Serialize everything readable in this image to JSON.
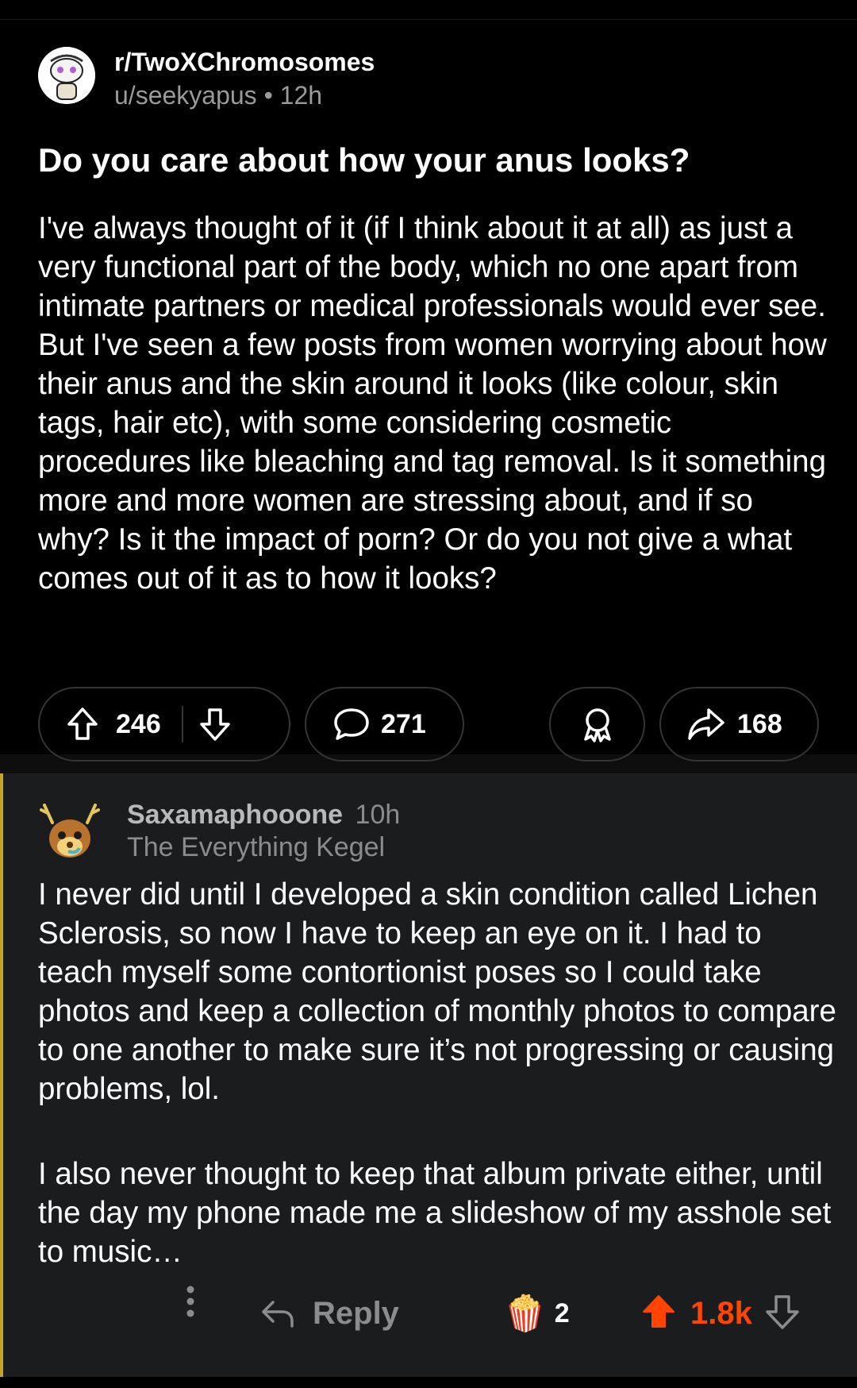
{
  "post": {
    "subreddit": "r/TwoXChromosomes",
    "user": "u/seekyapus",
    "separator": "•",
    "age": "12h",
    "title": "Do you care about how your anus looks?",
    "body": "I've always thought of it (if I think about it at all) as just a very functional part of the body, which no one apart from intimate partners or medical professionals would ever see.  But I've seen a few posts from women worrying about how their anus and the skin around it looks (like colour, skin tags, hair etc), with some considering cosmetic procedures like bleaching and tag removal. Is it something more and more women are stressing about, and if so why? Is it the impact of porn? Or do you not give a what comes out of it as to how it looks?",
    "upvotes": "246",
    "comments": "271",
    "shares": "168"
  },
  "comment": {
    "username": "Saxamaphooone",
    "age": "10h",
    "flair": "The Everything Kegel",
    "paragraphs": [
      "I never did until I developed a skin condition called Lichen Sclerosis, so now I have to keep an eye on it. I had to teach myself some contortionist poses so I could take photos and keep a collection of monthly photos to compare to one another to make sure it’s not progressing or causing problems, lol.",
      "I also never thought to keep that album private either, until the day my phone made me a slideshow of my asshole set to music…"
    ],
    "reply_label": "Reply",
    "award_icon": "popcorn-award-icon",
    "award_count": "2",
    "score": "1.8k"
  },
  "colors": {
    "background": "#000000",
    "comment_background": "#1a1c1e",
    "upvote_active": "#ff4500",
    "thread_line": "#c8a224",
    "muted_text": "#8a8c8e"
  }
}
